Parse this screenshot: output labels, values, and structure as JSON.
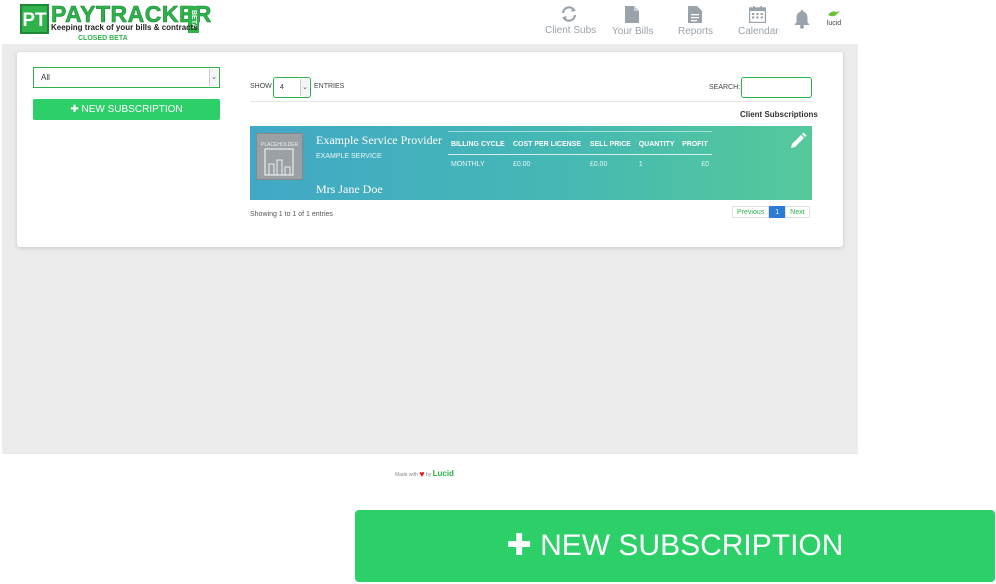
{
  "brand": {
    "pt": "PT",
    "name": "PAYTRACKER",
    "beta": "BETA",
    "tagline": "Keeping track of your bills & contracts",
    "closed_beta": "CLOSED BETA"
  },
  "nav": {
    "client_subs": "Client Subs",
    "your_bills": "Your Bills",
    "reports": "Reports",
    "calendar": "Calendar",
    "lucid": "lucid"
  },
  "sidebar": {
    "filter_value": "All",
    "new_sub_label": "NEW SUBSCRIPTION"
  },
  "table_controls": {
    "show_label": "SHOW",
    "show_value": "4",
    "entries_label": "ENTRIES",
    "search_label": "SEARCH:",
    "title": "Client Subscriptions"
  },
  "subscription": {
    "placeholder_text": "PLACEHOLDER",
    "provider": "Example Service Provider",
    "service": "EXAMPLE SERVICE",
    "customer": "Mrs Jane Doe",
    "headers": [
      "BILLING CYCLE",
      "COST PER LICENSE",
      "SELL PRICE",
      "QUANTITY",
      "PROFIT"
    ],
    "values": [
      "MONTHLY",
      "£0.00",
      "£0.00",
      "1",
      "£0"
    ]
  },
  "pagination": {
    "showing": "Showing 1 to 1 of 1 entries",
    "previous": "Previous",
    "page": "1",
    "next": "Next"
  },
  "footer": {
    "made_with": "Made with",
    "by": "by",
    "lucid": "Lucid"
  },
  "big_button": {
    "label": "NEW SUBSCRIPTION"
  },
  "colors": {
    "brand_green": "#2fb24c",
    "button_green": "#2dcf68",
    "row_gradient_start": "#41a8c6",
    "row_gradient_end": "#55c99a",
    "pager_active": "#2a7bd6"
  }
}
